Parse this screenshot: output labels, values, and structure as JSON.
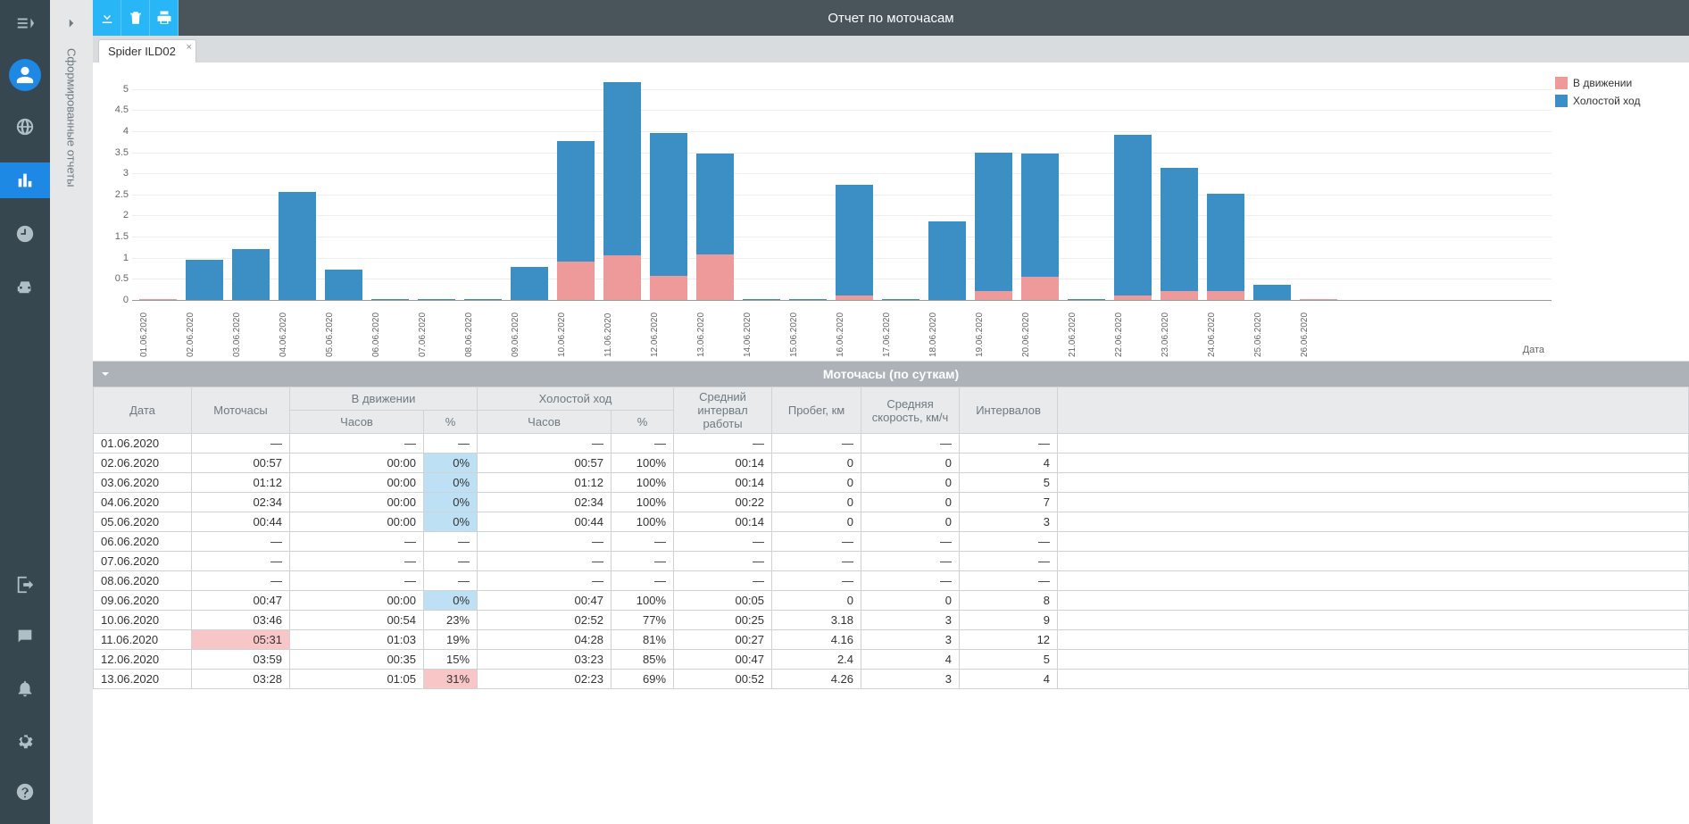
{
  "titlebar": {
    "title": "Отчет по моточасам"
  },
  "sidePanel": {
    "label": "Сформированные отчеты"
  },
  "tab": {
    "label": "Spider ILD02"
  },
  "legend": {
    "moving": "В движении",
    "idle": "Холостой ход"
  },
  "xAxisLabel": "Дата",
  "chart_data": {
    "type": "bar",
    "title": "Отчет по моточасам",
    "xlabel": "Дата",
    "ylabel": "",
    "ylim": [
      0,
      5.5
    ],
    "yticks": [
      0,
      0.5,
      1,
      1.5,
      2,
      2.5,
      3,
      3.5,
      4,
      4.5,
      5
    ],
    "categories": [
      "01.06.2020",
      "02.06.2020",
      "03.06.2020",
      "04.06.2020",
      "05.06.2020",
      "06.06.2020",
      "07.06.2020",
      "08.06.2020",
      "09.06.2020",
      "10.06.2020",
      "11.06.2020",
      "12.06.2020",
      "13.06.2020",
      "14.06.2020",
      "15.06.2020",
      "16.06.2020",
      "17.06.2020",
      "18.06.2020",
      "19.06.2020",
      "20.06.2020",
      "21.06.2020",
      "22.06.2020",
      "23.06.2020",
      "24.06.2020",
      "25.06.2020",
      "26.06.2020"
    ],
    "series": [
      {
        "name": "В движении",
        "color": "#ef9a9a",
        "values": [
          0.03,
          0,
          0,
          0,
          0,
          0,
          0,
          0,
          0,
          0.9,
          1.05,
          0.58,
          1.08,
          0,
          0,
          0.1,
          0,
          0,
          0.22,
          0.55,
          0,
          0.1,
          0.22,
          0.22,
          0,
          0.03
        ]
      },
      {
        "name": "Холостой ход",
        "color": "#3b8fc4",
        "values": [
          0,
          0.95,
          1.2,
          2.57,
          0.73,
          0.03,
          0.03,
          0.03,
          0.78,
          2.87,
          4.12,
          3.38,
          2.38,
          0.03,
          0.03,
          2.63,
          0.03,
          1.87,
          3.27,
          2.93,
          0.03,
          3.82,
          2.92,
          2.3,
          0.37,
          0
        ]
      }
    ]
  },
  "section": {
    "title": "Моточасы (по суткам)"
  },
  "table": {
    "headers": {
      "date": "Дата",
      "engine": "Моточасы",
      "moving": "В движении",
      "idle": "Холостой ход",
      "avgInterval": "Средний интервал работы",
      "mileage": "Пробег, км",
      "avgSpeed": "Средняя скорость, км/ч",
      "intervals": "Интервалов",
      "hours": "Часов",
      "percent": "%"
    },
    "rows": [
      {
        "date": "01.06.2020",
        "engine": "—",
        "mHours": "—",
        "mPct": "—",
        "iHours": "—",
        "iPct": "—",
        "avgInt": "—",
        "mileage": "—",
        "speed": "—",
        "ints": "—"
      },
      {
        "date": "02.06.2020",
        "engine": "00:57",
        "mHours": "00:00",
        "mPct": "0%",
        "mPctHl": "blue",
        "iHours": "00:57",
        "iPct": "100%",
        "avgInt": "00:14",
        "mileage": "0",
        "speed": "0",
        "ints": "4"
      },
      {
        "date": "03.06.2020",
        "engine": "01:12",
        "mHours": "00:00",
        "mPct": "0%",
        "mPctHl": "blue",
        "iHours": "01:12",
        "iPct": "100%",
        "avgInt": "00:14",
        "mileage": "0",
        "speed": "0",
        "ints": "5"
      },
      {
        "date": "04.06.2020",
        "engine": "02:34",
        "mHours": "00:00",
        "mPct": "0%",
        "mPctHl": "blue",
        "iHours": "02:34",
        "iPct": "100%",
        "avgInt": "00:22",
        "mileage": "0",
        "speed": "0",
        "ints": "7"
      },
      {
        "date": "05.06.2020",
        "engine": "00:44",
        "mHours": "00:00",
        "mPct": "0%",
        "mPctHl": "blue",
        "iHours": "00:44",
        "iPct": "100%",
        "avgInt": "00:14",
        "mileage": "0",
        "speed": "0",
        "ints": "3"
      },
      {
        "date": "06.06.2020",
        "engine": "—",
        "mHours": "—",
        "mPct": "—",
        "iHours": "—",
        "iPct": "—",
        "avgInt": "—",
        "mileage": "—",
        "speed": "—",
        "ints": "—"
      },
      {
        "date": "07.06.2020",
        "engine": "—",
        "mHours": "—",
        "mPct": "—",
        "iHours": "—",
        "iPct": "—",
        "avgInt": "—",
        "mileage": "—",
        "speed": "—",
        "ints": "—"
      },
      {
        "date": "08.06.2020",
        "engine": "—",
        "mHours": "—",
        "mPct": "—",
        "iHours": "—",
        "iPct": "—",
        "avgInt": "—",
        "mileage": "—",
        "speed": "—",
        "ints": "—"
      },
      {
        "date": "09.06.2020",
        "engine": "00:47",
        "mHours": "00:00",
        "mPct": "0%",
        "mPctHl": "blue",
        "iHours": "00:47",
        "iPct": "100%",
        "avgInt": "00:05",
        "mileage": "0",
        "speed": "0",
        "ints": "8"
      },
      {
        "date": "10.06.2020",
        "engine": "03:46",
        "mHours": "00:54",
        "mPct": "23%",
        "iHours": "02:52",
        "iPct": "77%",
        "avgInt": "00:25",
        "mileage": "3.18",
        "speed": "3",
        "ints": "9"
      },
      {
        "date": "11.06.2020",
        "engine": "05:31",
        "engineHl": "red",
        "mHours": "01:03",
        "mPct": "19%",
        "iHours": "04:28",
        "iPct": "81%",
        "avgInt": "00:27",
        "mileage": "4.16",
        "speed": "3",
        "ints": "12"
      },
      {
        "date": "12.06.2020",
        "engine": "03:59",
        "mHours": "00:35",
        "mPct": "15%",
        "iHours": "03:23",
        "iPct": "85%",
        "avgInt": "00:47",
        "mileage": "2.4",
        "speed": "4",
        "ints": "5"
      },
      {
        "date": "13.06.2020",
        "engine": "03:28",
        "mHours": "01:05",
        "mPct": "31%",
        "mPctHl": "red",
        "iHours": "02:23",
        "iPct": "69%",
        "avgInt": "00:52",
        "mileage": "4.26",
        "speed": "3",
        "ints": "4"
      }
    ]
  }
}
